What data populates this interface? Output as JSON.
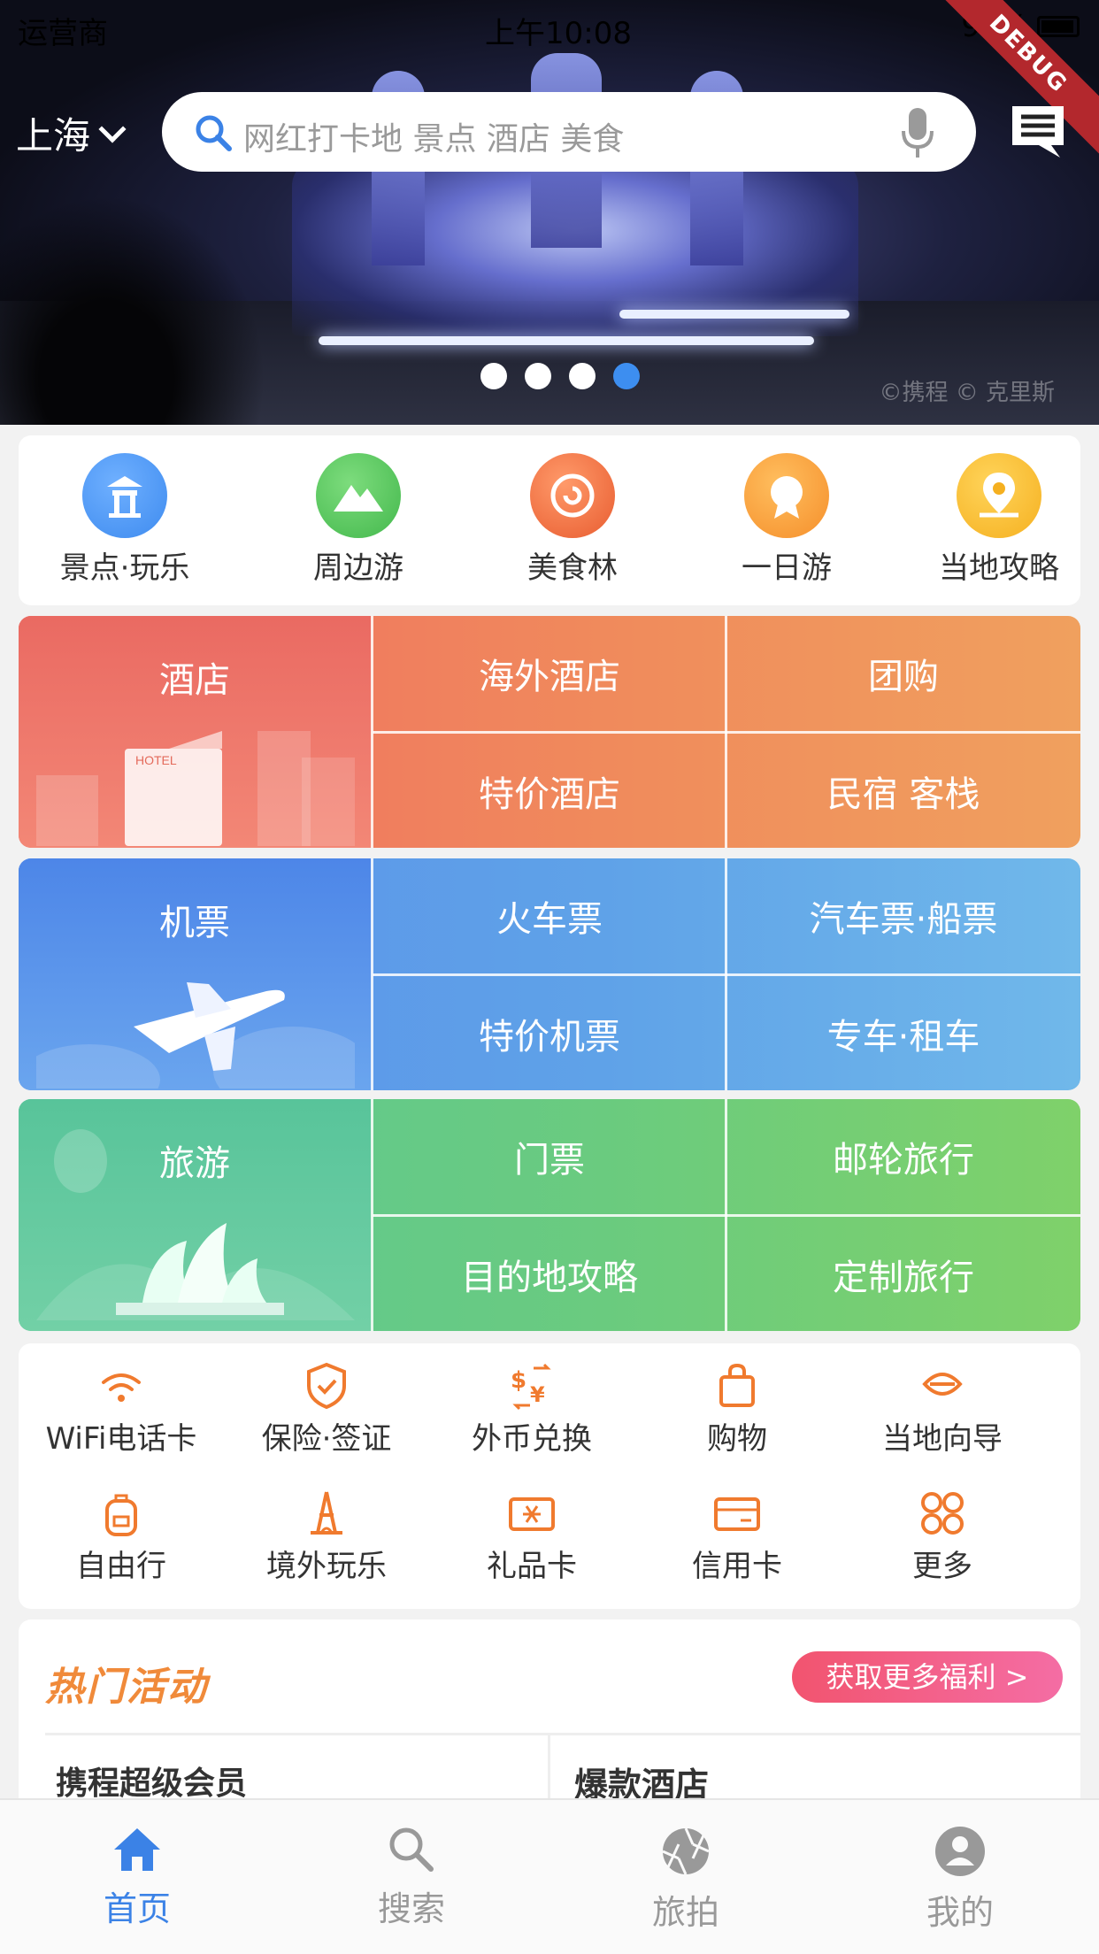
{
  "status_bar": {
    "carrier": "运营商",
    "time": "上午10:08",
    "battery": "90%"
  },
  "debug_label": "DEBUG",
  "header": {
    "city": "上海",
    "search_placeholder": "网红打卡地 景点 酒店 美食"
  },
  "banner": {
    "watermark": "©携程 © 克里斯",
    "slide_count": 4,
    "active_slide": 4
  },
  "quick_nav": [
    {
      "label": "景点·玩乐",
      "icon": "pavilion-icon",
      "color": "#3e8bef"
    },
    {
      "label": "周边游",
      "icon": "mountain-icon",
      "color": "#4cbf55"
    },
    {
      "label": "美食林",
      "icon": "food-icon",
      "color": "#ef6a3a"
    },
    {
      "label": "一日游",
      "icon": "badge-icon",
      "color": "#f59a34"
    },
    {
      "label": "当地攻略",
      "icon": "map-pin-icon",
      "color": "#f5b72b"
    }
  ],
  "grids": {
    "hotel": {
      "title": "酒店",
      "cells": [
        "海外酒店",
        "团购",
        "特价酒店",
        "民宿 客栈"
      ]
    },
    "flight": {
      "title": "机票",
      "cells": [
        "火车票",
        "汽车票·船票",
        "特价机票",
        "专车·租车"
      ]
    },
    "travel": {
      "title": "旅游",
      "cells": [
        "门票",
        "邮轮旅行",
        "目的地攻略",
        "定制旅行"
      ]
    }
  },
  "services": [
    {
      "label": "WiFi电话卡",
      "icon": "wifi-icon"
    },
    {
      "label": "保险·签证",
      "icon": "shield-icon"
    },
    {
      "label": "外币兑换",
      "icon": "currency-exchange-icon"
    },
    {
      "label": "购物",
      "icon": "shopping-bag-icon"
    },
    {
      "label": "当地向导",
      "icon": "guide-icon"
    },
    {
      "label": "自由行",
      "icon": "backpack-icon"
    },
    {
      "label": "境外玩乐",
      "icon": "eiffel-tower-icon"
    },
    {
      "label": "礼品卡",
      "icon": "gift-card-icon"
    },
    {
      "label": "信用卡",
      "icon": "credit-card-icon"
    },
    {
      "label": "更多",
      "icon": "more-grid-icon"
    }
  ],
  "hot_activity": {
    "title": "热门活动",
    "cta": "获取更多福利 >",
    "items": [
      "携程超级会员",
      "爆款酒店"
    ]
  },
  "tab_bar": [
    {
      "label": "首页",
      "icon": "home-icon",
      "active": true
    },
    {
      "label": "搜索",
      "icon": "search-icon",
      "active": false
    },
    {
      "label": "旅拍",
      "icon": "camera-shutter-icon",
      "active": false
    },
    {
      "label": "我的",
      "icon": "user-icon",
      "active": false
    }
  ],
  "colors": {
    "accent": "#3b82e6",
    "service_orange": "#f07a2e",
    "hot_title": "#f08a3a"
  }
}
